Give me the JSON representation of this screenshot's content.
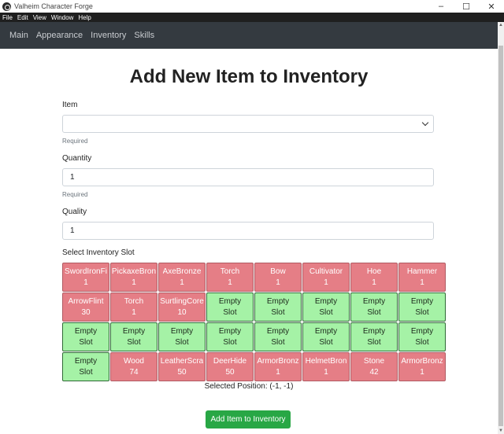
{
  "window": {
    "title": "Valheim Character Forge",
    "minimize": "–",
    "maximize": "☐",
    "close": "✕"
  },
  "menu": [
    "File",
    "Edit",
    "View",
    "Window",
    "Help"
  ],
  "nav": [
    "Main",
    "Appearance",
    "Inventory",
    "Skills"
  ],
  "page": {
    "title": "Add New Item to Inventory"
  },
  "form": {
    "item": {
      "label": "Item",
      "value": "",
      "hint": "Required"
    },
    "quantity": {
      "label": "Quantity",
      "value": "1",
      "hint": "Required"
    },
    "quality": {
      "label": "Quality",
      "value": "1"
    },
    "slot_label": "Select Inventory Slot"
  },
  "slots": [
    {
      "name": "SwordIronFi",
      "count": "1"
    },
    {
      "name": "PickaxeBron",
      "count": "1"
    },
    {
      "name": "AxeBronze",
      "count": "1"
    },
    {
      "name": "Torch",
      "count": "1"
    },
    {
      "name": "Bow",
      "count": "1"
    },
    {
      "name": "Cultivator",
      "count": "1"
    },
    {
      "name": "Hoe",
      "count": "1"
    },
    {
      "name": "Hammer",
      "count": "1"
    },
    {
      "name": "ArrowFlint",
      "count": "30"
    },
    {
      "name": "Torch",
      "count": "1"
    },
    {
      "name": "SurtlingCore",
      "count": "10"
    },
    {
      "name": "Empty",
      "count": "Slot",
      "empty": true
    },
    {
      "name": "Empty",
      "count": "Slot",
      "empty": true
    },
    {
      "name": "Empty",
      "count": "Slot",
      "empty": true
    },
    {
      "name": "Empty",
      "count": "Slot",
      "empty": true
    },
    {
      "name": "Empty",
      "count": "Slot",
      "empty": true
    },
    {
      "name": "Empty",
      "count": "Slot",
      "empty": true
    },
    {
      "name": "Empty",
      "count": "Slot",
      "empty": true
    },
    {
      "name": "Empty",
      "count": "Slot",
      "empty": true
    },
    {
      "name": "Empty",
      "count": "Slot",
      "empty": true
    },
    {
      "name": "Empty",
      "count": "Slot",
      "empty": true
    },
    {
      "name": "Empty",
      "count": "Slot",
      "empty": true
    },
    {
      "name": "Empty",
      "count": "Slot",
      "empty": true
    },
    {
      "name": "Empty",
      "count": "Slot",
      "empty": true
    },
    {
      "name": "Empty",
      "count": "Slot",
      "empty": true
    },
    {
      "name": "Wood",
      "count": "74"
    },
    {
      "name": "LeatherScra",
      "count": "50"
    },
    {
      "name": "DeerHide",
      "count": "50"
    },
    {
      "name": "ArmorBronz",
      "count": "1"
    },
    {
      "name": "HelmetBron",
      "count": "1"
    },
    {
      "name": "Stone",
      "count": "42"
    },
    {
      "name": "ArmorBronz",
      "count": "1"
    }
  ],
  "selected_position": "Selected Position: (-1, -1)",
  "submit_label": "Add Item to Inventory",
  "colors": {
    "filled": "#e57e86",
    "empty": "#a5f2a6",
    "submit": "#28a745",
    "navbar": "#343a40"
  }
}
